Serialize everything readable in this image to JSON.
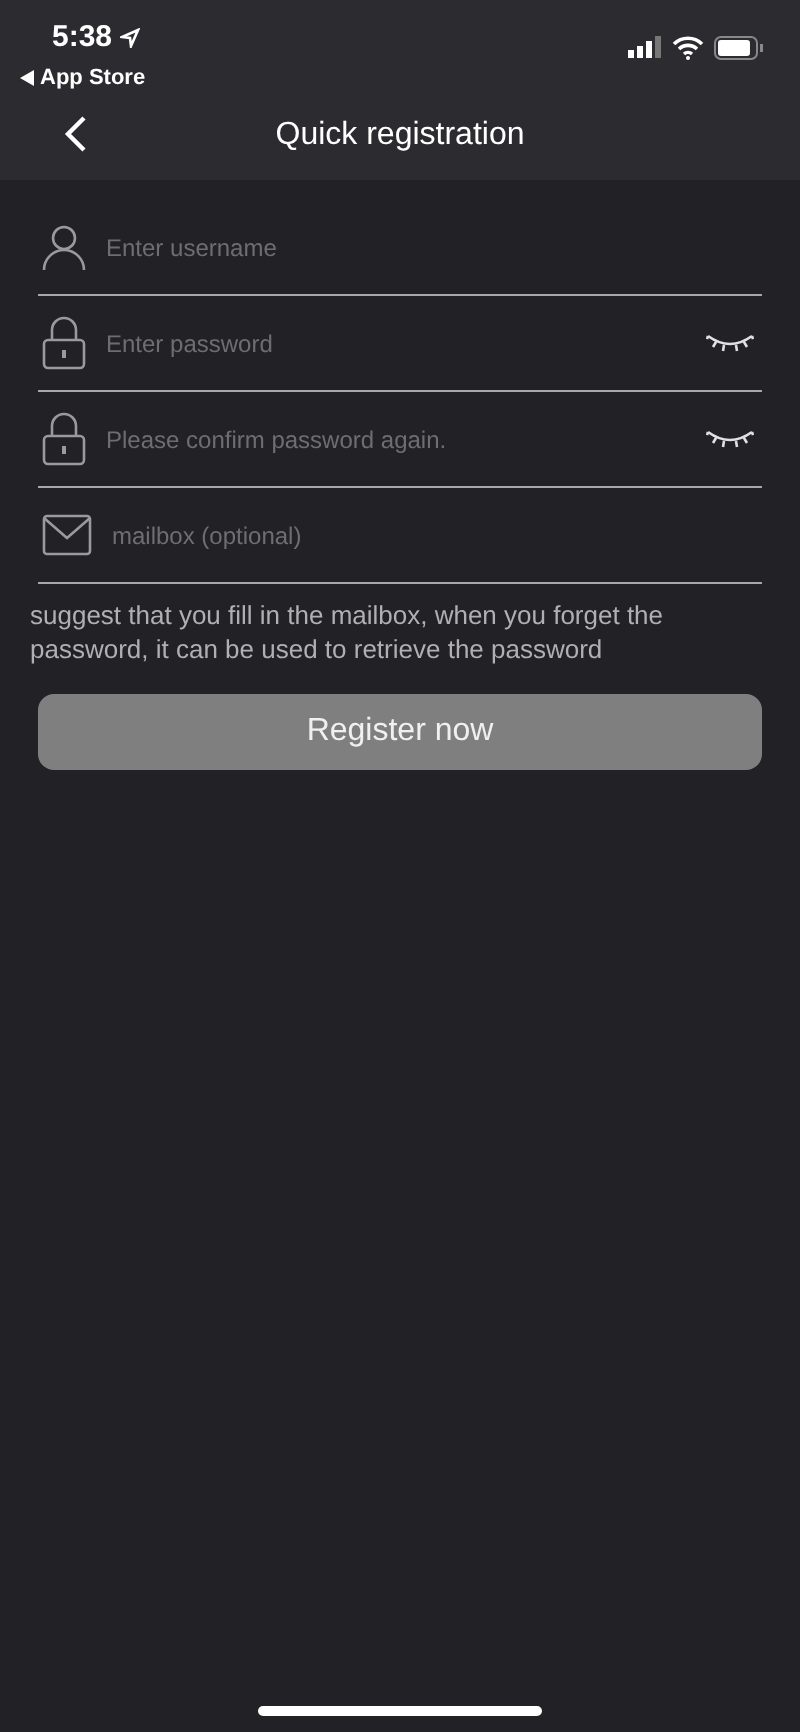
{
  "status_bar": {
    "time": "5:38",
    "back_app": "App Store"
  },
  "nav": {
    "title": "Quick registration"
  },
  "fields": [
    {
      "kind": "user",
      "placeholder": "Enter username",
      "eye": false
    },
    {
      "kind": "lock",
      "placeholder": "Enter password",
      "eye": true
    },
    {
      "kind": "lock",
      "placeholder": "Please confirm password again.",
      "eye": true
    },
    {
      "kind": "mail",
      "placeholder": "mailbox (optional)",
      "eye": false
    }
  ],
  "hint": "suggest that you fill in the mailbox, when you forget the password, it can be used to retrieve the password",
  "button": {
    "label": "Register now",
    "disabled": true
  }
}
